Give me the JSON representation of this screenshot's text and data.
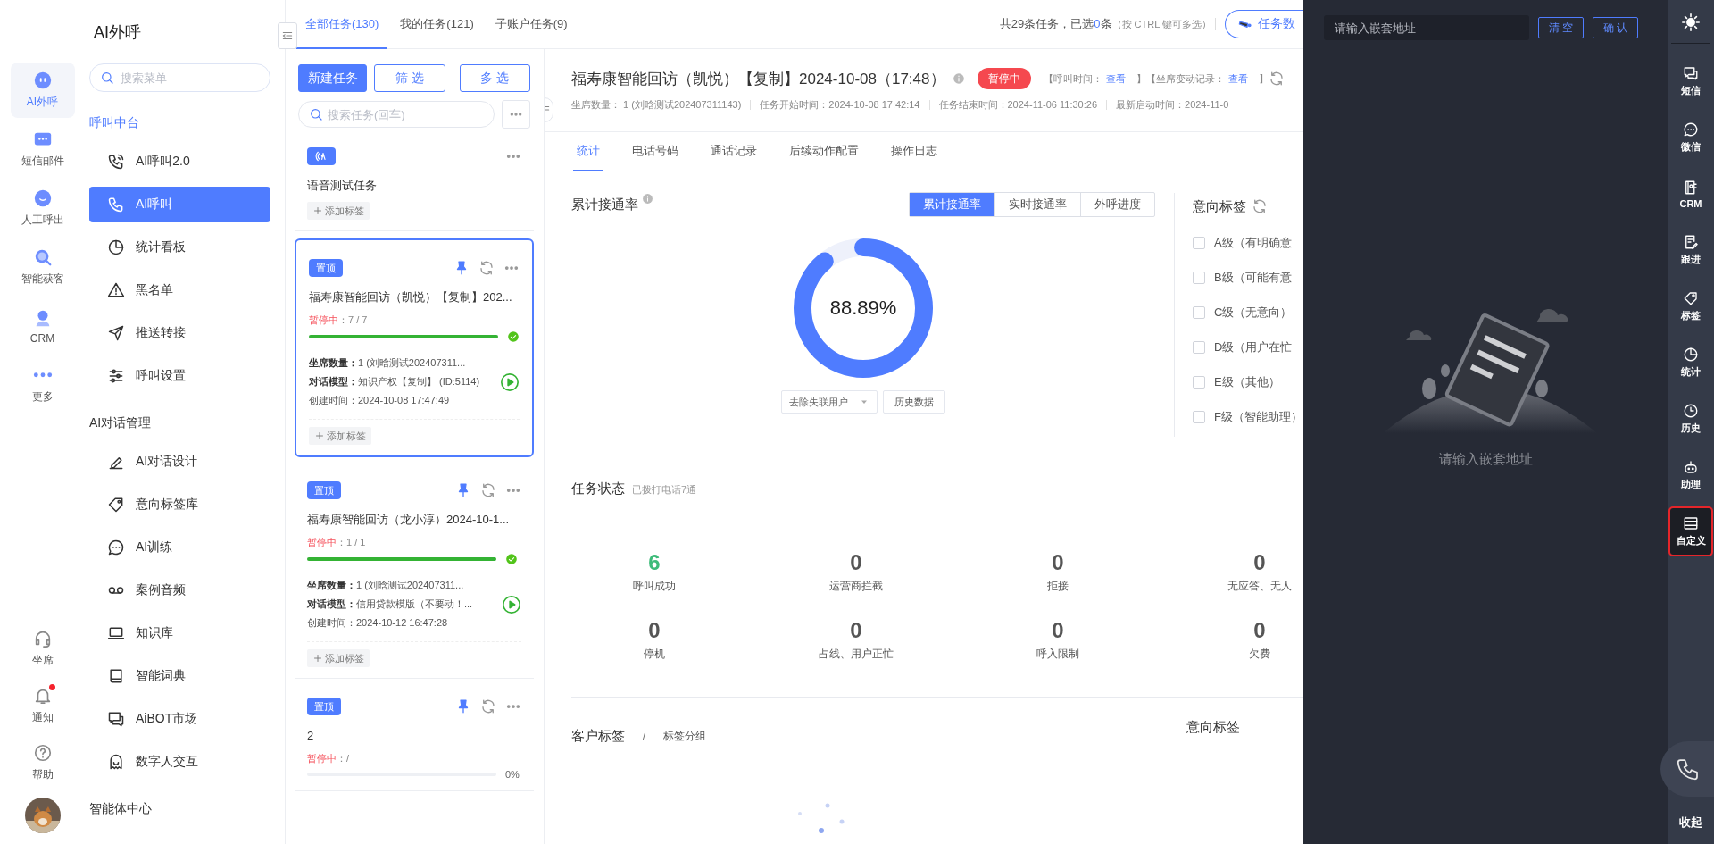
{
  "nav": {
    "items": [
      {
        "label": "AI外呼",
        "kind": "bot",
        "selected": true
      },
      {
        "label": "短信邮件",
        "kind": "message",
        "selected": false
      },
      {
        "label": "人工呼出",
        "kind": "smile",
        "selected": false
      },
      {
        "label": "智能获客",
        "kind": "search",
        "selected": false
      },
      {
        "label": "CRM",
        "kind": "user",
        "selected": false
      },
      {
        "label": "更多",
        "kind": "dots",
        "selected": false
      }
    ],
    "bottom": [
      {
        "label": "坐席",
        "kind": "headset",
        "badge": false
      },
      {
        "label": "通知",
        "kind": "bell",
        "badge": true
      },
      {
        "label": "帮助",
        "kind": "help",
        "badge": false
      }
    ]
  },
  "sidebar": {
    "title": "AI外呼",
    "search": {
      "placeholder": "搜索菜单"
    },
    "groups": [
      {
        "label": "呼叫中台",
        "active": true,
        "items": [
          {
            "label": "AI呼叫2.0",
            "kind": "phone-call",
            "selected": false
          },
          {
            "label": "AI呼叫",
            "kind": "phone",
            "selected": true
          },
          {
            "label": "统计看板",
            "kind": "pie",
            "selected": false
          },
          {
            "label": "黑名单",
            "kind": "warning",
            "selected": false
          },
          {
            "label": "推送转接",
            "kind": "send",
            "selected": false
          },
          {
            "label": "呼叫设置",
            "kind": "sliders",
            "selected": false
          }
        ]
      },
      {
        "label": "AI对话管理",
        "active": false,
        "items": [
          {
            "label": "AI对话设计",
            "kind": "pen",
            "selected": false
          },
          {
            "label": "意向标签库",
            "kind": "tag",
            "selected": false
          },
          {
            "label": "AI训练",
            "kind": "chat",
            "selected": false
          },
          {
            "label": "案例音频",
            "kind": "voicemail",
            "selected": false
          },
          {
            "label": "知识库",
            "kind": "laptop",
            "selected": false
          },
          {
            "label": "智能词典",
            "kind": "book",
            "selected": false
          },
          {
            "label": "AiBOT市场",
            "kind": "messages",
            "selected": false
          },
          {
            "label": "数字人交互",
            "kind": "ghost",
            "selected": false
          }
        ]
      },
      {
        "label": "智能体中心",
        "active": false
      }
    ]
  },
  "task_tabs": [
    {
      "label": "全部任务(130)",
      "selected": true
    },
    {
      "label": "我的任务(121)",
      "selected": false
    },
    {
      "label": "子账户任务(9)",
      "selected": false
    }
  ],
  "selection_summary": {
    "text": "共29条任务，已选",
    "count": "0",
    "suffix": "条",
    "hint": "（按 CTRL 键可多选）"
  },
  "export_button": {
    "label": "任务数"
  },
  "task_list": {
    "buttons": [
      {
        "label": "新建任务",
        "kind": "primary"
      },
      {
        "label": "筛 选",
        "kind": "outline"
      },
      {
        "label": "多 选",
        "kind": "outline"
      }
    ],
    "search": {
      "placeholder": "搜索任务(回车)"
    },
    "tasks": [
      {
        "tag": {
          "kind": "icon"
        },
        "pinned": false,
        "title": "语音测试任务",
        "selected": false,
        "add_tag": "添加标签"
      },
      {
        "tag": {
          "kind": "text",
          "label": "置顶"
        },
        "pinned": true,
        "title": "福寿康智能回访（凯悦）【复制】202...",
        "selected": true,
        "status": "暂停中",
        "progress_text": "：7 / 7",
        "level": 1,
        "done": true,
        "details": [
          {
            "label": "坐席数量：",
            "value": "1 (刘晗测试202407311...",
            "strong": true
          },
          {
            "label": "对话模型：",
            "value": "知识产权【复制】 (ID:5114)",
            "strong": true
          },
          {
            "label": "创建时间：",
            "value": "2024-10-08 17:47:49",
            "strong": false
          }
        ],
        "playable": true,
        "add_tag": "添加标签"
      },
      {
        "tag": {
          "kind": "text",
          "label": "置顶"
        },
        "pinned": true,
        "title": "福寿康智能回访（龙小淳）2024-10-1...",
        "selected": false,
        "status": "暂停中",
        "progress_text": "：1 / 1",
        "level": 1,
        "done": true,
        "details": [
          {
            "label": "坐席数量：",
            "value": "1 (刘晗测试202407311...",
            "strong": true
          },
          {
            "label": "对话模型：",
            "value": "信用贷款模版（不要动！...",
            "strong": true
          },
          {
            "label": "创建时间：",
            "value": "2024-10-12 16:47:28",
            "strong": false
          }
        ],
        "playable": true,
        "add_tag": "添加标签"
      },
      {
        "tag": {
          "kind": "text",
          "label": "置顶"
        },
        "pinned": true,
        "title": "2",
        "selected": false,
        "status": "暂停中",
        "progress_text": "：/",
        "level": 0,
        "done": false,
        "percent": "0%"
      }
    ]
  },
  "detail": {
    "title": "福寿康智能回访（凯悦）【复制】2024-10-08（17:48）",
    "status_badge": "暂停中",
    "links": [
      {
        "label": "【呼叫时间：",
        "link": "查看",
        "end": "】"
      },
      {
        "label": "【坐席变动记录：",
        "link": "查看",
        "end": "】"
      }
    ],
    "meta": [
      "坐席数量： 1 (刘晗测试202407311143)",
      "任务开始时间：2024-10-08 17:42:14",
      "任务结束时间：2024-11-06 11:30:26",
      "最新启动时间：2024-11-0"
    ],
    "tabs": [
      {
        "label": "统计",
        "selected": true
      },
      {
        "label": "电话号码",
        "selected": false
      },
      {
        "label": "通话记录",
        "selected": false
      },
      {
        "label": "后续动作配置",
        "selected": false
      },
      {
        "label": "操作日志",
        "selected": false
      }
    ],
    "rate": {
      "title": "累计接通率",
      "segments": [
        {
          "label": "累计接通率",
          "selected": true
        },
        {
          "label": "实时接通率",
          "selected": false
        },
        {
          "label": "外呼进度",
          "selected": false
        }
      ],
      "value": "88.89%",
      "level": 0.8889,
      "filter": "去除失联用户",
      "history_button": "历史数据"
    },
    "intent": {
      "title": "意向标签",
      "options": [
        {
          "label": "A级（有明确意",
          "checked": false
        },
        {
          "label": "B级（可能有意",
          "checked": false
        },
        {
          "label": "C级（无意向）",
          "checked": false
        },
        {
          "label": "D级（用户在忙",
          "checked": false
        },
        {
          "label": "E级（其他）",
          "checked": false
        },
        {
          "label": "F级（智能助理）",
          "checked": false
        }
      ]
    },
    "status": {
      "title": "任务状态",
      "subtitle": "已拨打电话7通",
      "stats": [
        {
          "value": "6",
          "label": "呼叫成功",
          "kind": "success"
        },
        {
          "value": "0",
          "label": "运营商拦截",
          "kind": "normal"
        },
        {
          "value": "0",
          "label": "拒接",
          "kind": "normal"
        },
        {
          "value": "0",
          "label": "无应答、无人",
          "kind": "normal"
        },
        {
          "value": "0",
          "label": "停机",
          "kind": "normal"
        },
        {
          "value": "0",
          "label": "占线、用户正忙",
          "kind": "normal"
        },
        {
          "value": "0",
          "label": "呼入限制",
          "kind": "normal"
        },
        {
          "value": "0",
          "label": "欠费",
          "kind": "normal"
        }
      ]
    },
    "customer_tags": {
      "title": "客户标签",
      "separator": "/",
      "subtitle": "标签分组"
    },
    "intent_tags": {
      "title": "意向标签"
    }
  },
  "embed_panel": {
    "address": {
      "placeholder": "请输入嵌套地址"
    },
    "buttons": [
      "清 空",
      "确 认"
    ],
    "empty_text": "请输入嵌套地址"
  },
  "rail": {
    "items": [
      {
        "label": "短信",
        "kind": "messages",
        "selected": false
      },
      {
        "label": "微信",
        "kind": "chat",
        "selected": false
      },
      {
        "label": "CRM",
        "kind": "contacts",
        "selected": false
      },
      {
        "label": "跟进",
        "kind": "edit",
        "selected": false
      },
      {
        "label": "标签",
        "kind": "tag",
        "selected": false
      },
      {
        "label": "统计",
        "kind": "pie",
        "selected": false
      },
      {
        "label": "历史",
        "kind": "clock",
        "selected": false
      },
      {
        "label": "助理",
        "kind": "robot",
        "selected": false
      },
      {
        "label": "自定义",
        "kind": "window",
        "selected": true
      }
    ],
    "collapse": "收起"
  }
}
